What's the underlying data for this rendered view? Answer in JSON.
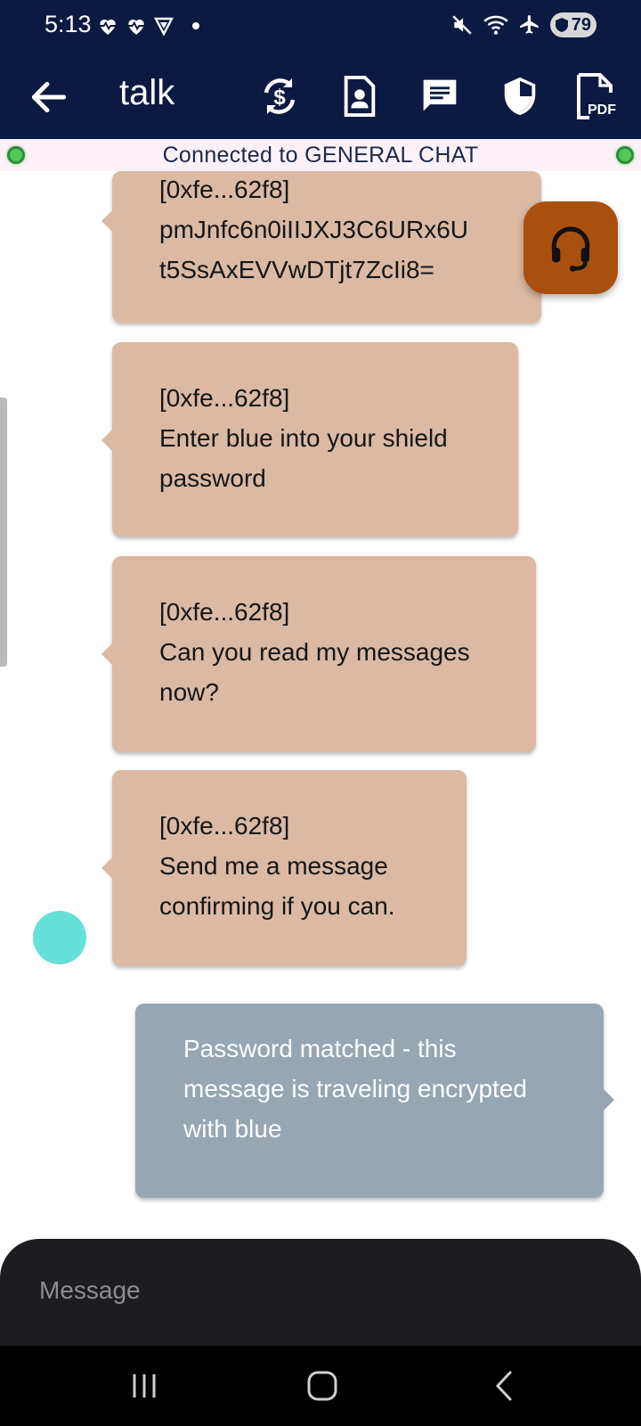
{
  "status_bar": {
    "time": "5:13",
    "battery": "79",
    "icons_left": [
      "heart-monitor-icon",
      "heart-monitor-icon",
      "vpn-shield-icon",
      "dot-icon"
    ],
    "icons_right": [
      "mute-icon",
      "wifi-icon",
      "airplane-icon",
      "battery-icon"
    ]
  },
  "app_bar": {
    "title": "talk",
    "back_icon": "arrow-left-icon",
    "actions": [
      "currency-sync-icon",
      "contact-card-icon",
      "chat-icon",
      "shield-icon",
      "pdf-icon"
    ],
    "pdf_label": "PDF"
  },
  "connection": {
    "text": "Connected to GENERAL CHAT",
    "indicator_color": "#55c85a"
  },
  "messages": [
    {
      "sender": "[0xfe...62f8]",
      "text": "pmJnfc6n0iIIJXJ3C6URx6U\nt5SsAxEVVwDTjt7ZcIi8=",
      "incoming": true
    },
    {
      "sender": "[0xfe...62f8]",
      "text": "Enter blue into your shield\npassword",
      "incoming": true
    },
    {
      "sender": "[0xfe...62f8]",
      "text": "Can you read my messages\nnow?",
      "incoming": true
    },
    {
      "sender": "[0xfe...62f8]",
      "text": "Send me a message\nconfirming if you can.",
      "incoming": true
    },
    {
      "text": "Password matched - this\nmessage is traveling encrypted\nwith blue",
      "incoming": false
    }
  ],
  "composer": {
    "placeholder": "Message"
  },
  "colors": {
    "header_bg": "#0b1a40",
    "incoming_bubble": "#dbb9a3",
    "outgoing_bubble": "#97a6b3",
    "support_fab": "#a9500f",
    "avatar": "#66e0d8"
  },
  "nav": [
    "recents-icon",
    "home-icon",
    "back-icon"
  ]
}
